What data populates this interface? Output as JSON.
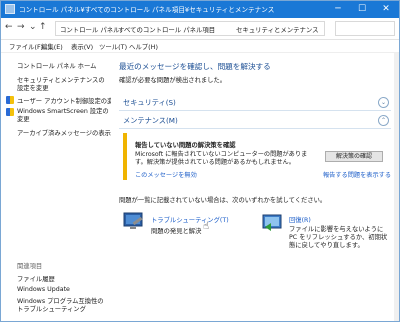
{
  "window": {
    "title": "コントロール パネル¥すべてのコントロール パネル項目¥セキュリティとメンテナンス"
  },
  "address": {
    "crumbs": [
      "コントロール パネル",
      "すべてのコントロール パネル項目",
      "セキュリティとメンテナンス"
    ]
  },
  "menu": [
    "ファイル(F)",
    "編集(E)",
    "表示(V)",
    "ツール(T)",
    "ヘルプ(H)"
  ],
  "sidebar": {
    "home": "コントロール パネル ホーム",
    "items": [
      "セキュリティとメンテナンスの設定を変更",
      "ユーザー アカウント制御設定の変更",
      "Windows SmartScreen 設定の変更",
      "アーカイブ済みメッセージの表示"
    ],
    "related_title": "関連項目",
    "related": [
      "ファイル履歴",
      "Windows Update",
      "Windows プログラム互換性のトラブルシューティング"
    ]
  },
  "main": {
    "heading": "最近のメッセージを確認し、問題を解決する",
    "subheading": "確認が必要な問題が検出されました。",
    "security_label": "セキュリティ(S)",
    "maintenance_label": "メンテナンス(M)",
    "message": {
      "title": "報告していない問題の解決策を確認",
      "body": "Microsoft に報告されていないコンピューターの問題があります。解決策が提供されている問題があるかもしれません。",
      "off_link": "このメッセージを無効",
      "button": "解決策の確認",
      "report_link": "報告する問題を表示する"
    },
    "hint": "問題が一覧に記載されていない場合は、次のいずれかを試してください。",
    "troubleshoot": {
      "title": "トラブルシューティング(T)",
      "desc": "問題の発見と解決"
    },
    "recovery": {
      "title": "回復(R)",
      "desc": "ファイルに影響を与えないように PC をリフレッシュするか、初期状態に戻してやり直します。"
    }
  }
}
